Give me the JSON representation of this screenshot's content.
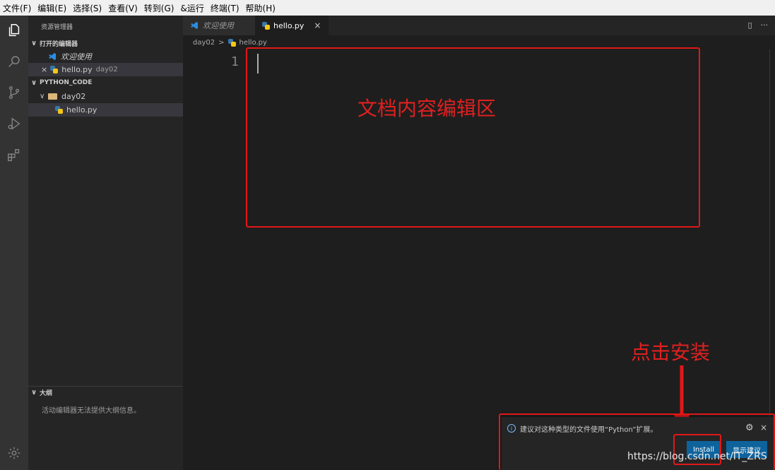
{
  "menu": [
    "文件(F)",
    "编辑(E)",
    "选择(S)",
    "查看(V)",
    "转到(G)",
    "&运行",
    "终端(T)",
    "帮助(H)"
  ],
  "activity_icons": [
    "explorer-icon",
    "search-icon",
    "source-control-icon",
    "run-debug-icon",
    "extensions-icon",
    "settings-gear-icon"
  ],
  "sidebar": {
    "title": "资源管理器",
    "open_editors": {
      "label": "打开的编辑器",
      "items": [
        {
          "name": "欢迎使用"
        },
        {
          "name": "hello.py",
          "folder": "day02",
          "close": "×"
        }
      ]
    },
    "workspace": {
      "label": "PYTHON_CODE",
      "folder": "day02",
      "file": "hello.py"
    },
    "outline": {
      "label": "大纲",
      "message": "活动编辑器无法提供大纲信息。"
    }
  },
  "tabs": [
    {
      "label": "欢迎使用"
    },
    {
      "label": "hello.py",
      "close": "×"
    }
  ],
  "tab_actions": [
    "▯",
    "···"
  ],
  "breadcrumb": {
    "folder": "day02",
    "separator": ">",
    "file": "hello.py"
  },
  "editor": {
    "line_number": "1"
  },
  "annotations": {
    "edit_area_label": "文档内容编辑区",
    "install_label": "点击安装",
    "color": "#e01818"
  },
  "notification": {
    "info_icon": "i",
    "message": "建议对这种类型的文件使用“Python”扩展。",
    "gear": "⚙",
    "close": "×",
    "install_button": "Install",
    "show_button": "显示建议"
  },
  "watermark": "https://blog.csdn.net/IT_ZRS"
}
